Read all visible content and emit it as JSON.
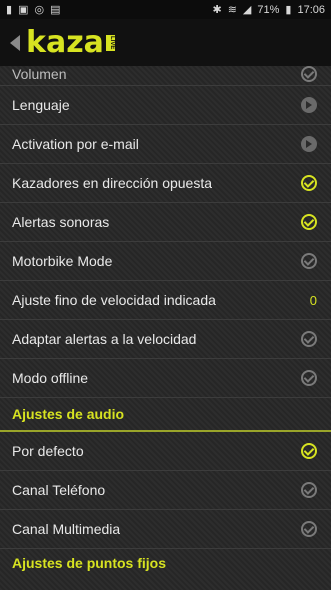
{
  "status": {
    "battery": "71%",
    "time": "17:06"
  },
  "header": {
    "logo": "kaza",
    "badge": "LIVE"
  },
  "partial_row": "Volumen",
  "settings": [
    {
      "label": "Lenguaje",
      "control": "arrow"
    },
    {
      "label": "Activation por e-mail",
      "control": "arrow"
    },
    {
      "label": "Kazadores en dirección opuesta",
      "control": "check-on"
    },
    {
      "label": "Alertas sonoras",
      "control": "check-on"
    },
    {
      "label": "Motorbike Mode",
      "control": "check-off"
    },
    {
      "label": "Ajuste fino de velocidad indicada",
      "control": "value",
      "value": "0"
    },
    {
      "label": "Adaptar alertas a la velocidad",
      "control": "check-off"
    },
    {
      "label": "Modo offline",
      "control": "check-off"
    }
  ],
  "audio_section": {
    "title": "Ajustes de audio",
    "items": [
      {
        "label": "Por defecto",
        "control": "check-on"
      },
      {
        "label": "Canal Teléfono",
        "control": "check-off"
      },
      {
        "label": "Canal Multimedia",
        "control": "check-off"
      }
    ]
  },
  "fixed_points_section": {
    "title": "Ajustes de puntos fijos"
  },
  "colors": {
    "accent": "#d7e321",
    "background": "#2b2b2b"
  }
}
